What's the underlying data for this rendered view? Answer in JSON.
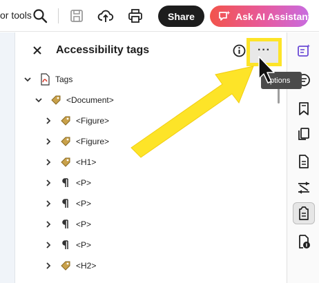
{
  "toolbar": {
    "search_tools_text": "or tools",
    "share_label": "Share",
    "ai_label": "Ask AI Assistant",
    "icons": [
      "search-icon",
      "save-icon",
      "upload-cloud-icon",
      "print-icon",
      "ai-chat-sparkle-icon"
    ]
  },
  "panel": {
    "title": "Accessibility tags",
    "options_label": "···",
    "tooltip": "ptions"
  },
  "tree": [
    {
      "label": "Tags",
      "icon": "pdf-tags-icon"
    },
    {
      "label": "<Document>",
      "icon": "tag-icon"
    },
    {
      "label": "<Figure>",
      "icon": "tag-icon"
    },
    {
      "label": "<Figure>",
      "icon": "tag-icon"
    },
    {
      "label": "<H1>",
      "icon": "tag-icon"
    },
    {
      "label": "<P>",
      "icon": "paragraph-icon"
    },
    {
      "label": "<P>",
      "icon": "paragraph-icon"
    },
    {
      "label": "<P>",
      "icon": "paragraph-icon"
    },
    {
      "label": "<P>",
      "icon": "paragraph-icon"
    },
    {
      "label": "<H2>",
      "icon": "tag-icon"
    }
  ],
  "rail_icons": [
    "edit-sparkle-icon",
    "comment-icon",
    "bookmark-icon",
    "pages-icon",
    "document-icon",
    "compare-icon",
    "accessibility-tags-icon",
    "reading-order-icon"
  ],
  "colors": {
    "highlight_yellow": "#fde428",
    "accent_purple": "#6b4bd6",
    "share_bg": "#1d1d1d",
    "ai_gradient_start": "#f2544b",
    "ai_gradient_end": "#c86ce0"
  }
}
